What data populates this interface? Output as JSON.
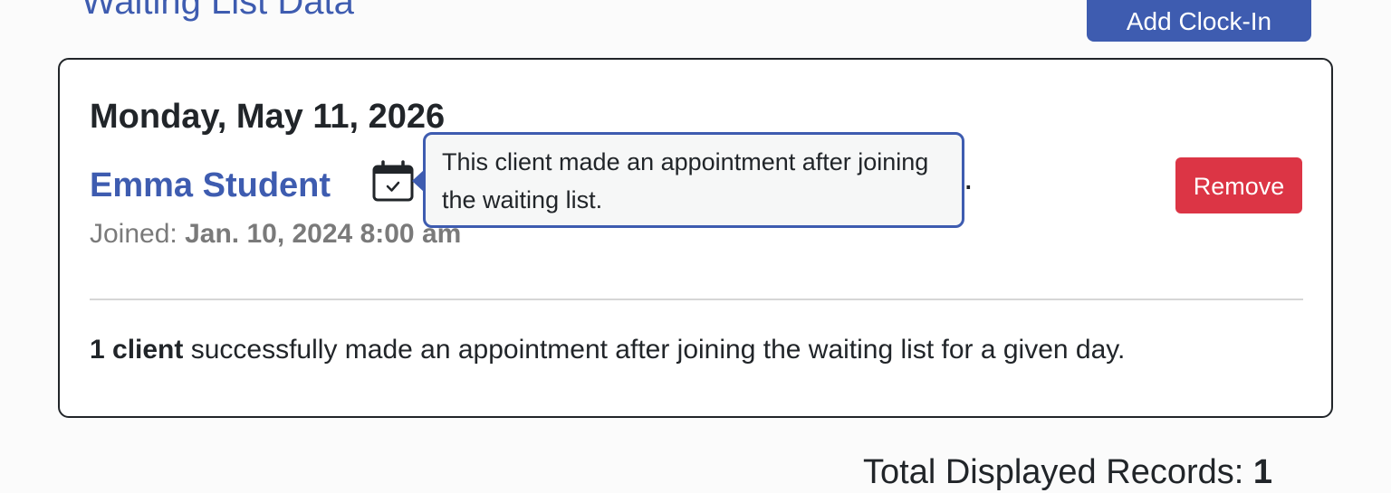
{
  "header": {
    "title": "Waiting List Data",
    "add_clock_in_label": "Add Clock-In"
  },
  "card": {
    "date": "Monday, May 11, 2026",
    "entry": {
      "client_name": "Emma Student",
      "trailing_text": ".",
      "joined_label": "Joined:",
      "joined_value": "Jan. 10, 2024 8:00 am",
      "remove_label": "Remove",
      "status_icon": "calendar-check-icon"
    },
    "tooltip": "This client made an appointment after joining the waiting list.",
    "summary": {
      "count": "1 client",
      "text": "successfully made an appointment after joining the waiting list for a given day."
    }
  },
  "footer": {
    "total_label": "Total Displayed Records:",
    "total_value": "1"
  },
  "colors": {
    "brand": "#3e5cb0",
    "danger": "#dc3545",
    "muted_text": "#7a7a7a",
    "text": "#212529"
  }
}
